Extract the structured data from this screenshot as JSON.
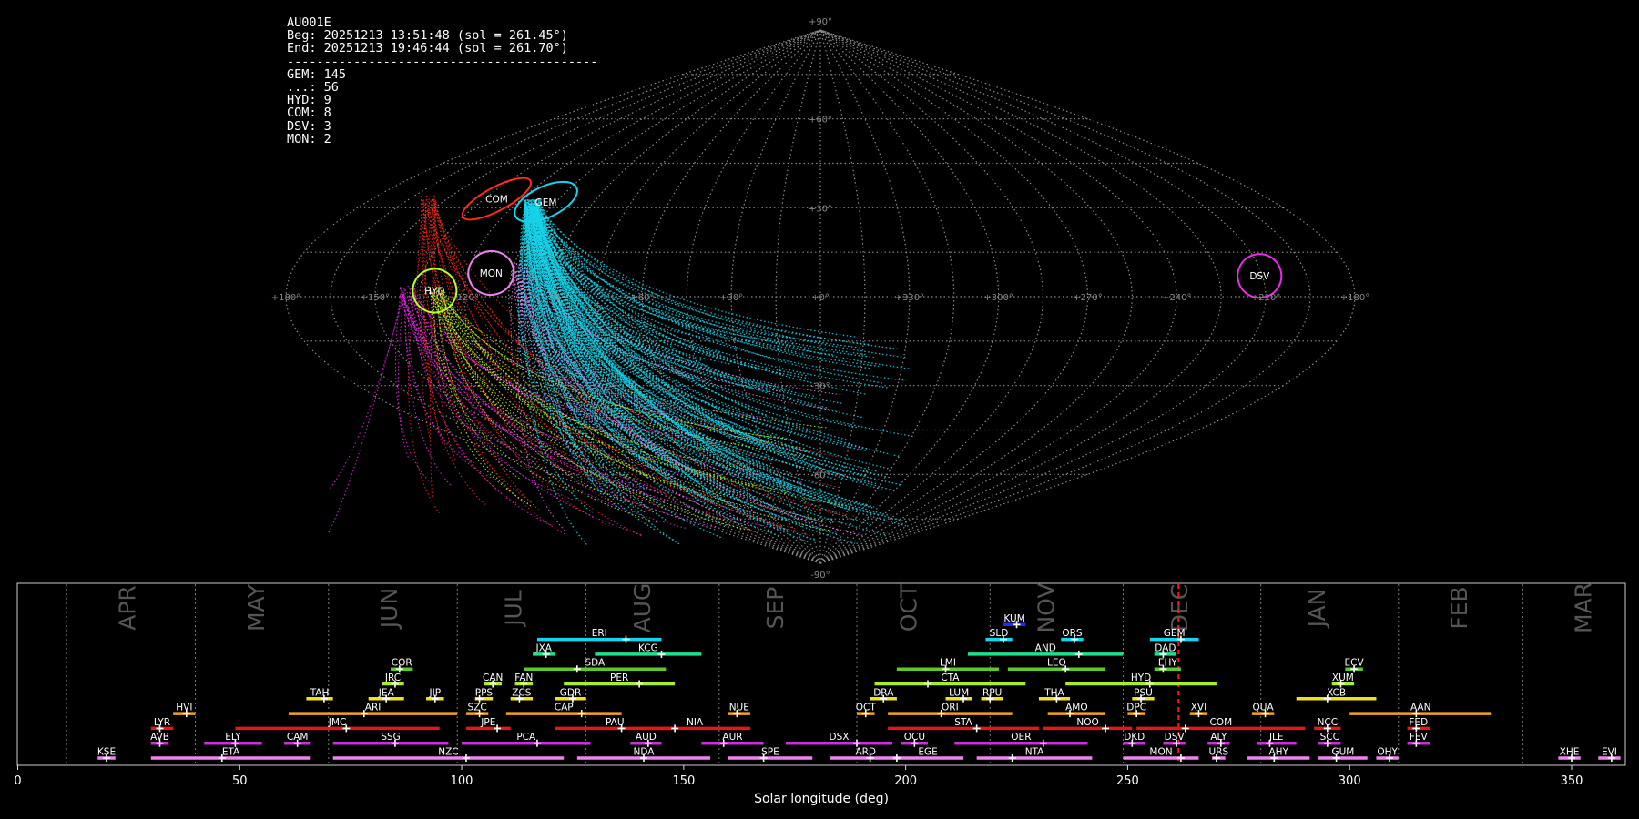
{
  "info": {
    "station": "AU001E",
    "begin": "Beg: 20251213 13:51:48 (sol = 261.45°)",
    "end": "End: 20251213 19:46:44 (sol = 261.70°)",
    "separator": "------------------------------------------",
    "counts": [
      "GEM: 145",
      "...: 56",
      "HYD: 9",
      "COM: 8",
      "DSV: 3",
      "MON: 2"
    ]
  },
  "chart_data": [
    {
      "type": "scatter",
      "projection": "sinusoidal",
      "grid": true,
      "lat_labels": [
        {
          "lat": 90,
          "text": "+90°"
        },
        {
          "lat": 60,
          "text": "+60°"
        },
        {
          "lat": 30,
          "text": "+30°"
        },
        {
          "lat": -30,
          "text": "-30°"
        },
        {
          "lat": -60,
          "text": "-60°"
        },
        {
          "lat": -90,
          "text": "-90°"
        }
      ],
      "lon_labels": [
        "+180°",
        "+150°",
        "+120°",
        "+90°",
        "+60°",
        "+30°",
        "+0°",
        "+330°",
        "+300°",
        "+270°",
        "+240°",
        "+210°",
        "+180°"
      ],
      "radiants": [
        {
          "name": "COM",
          "color": "#ff2a1a",
          "lon": 130,
          "lat": 33
        },
        {
          "name": "GEM",
          "color": "#18d4ea",
          "lon": 109,
          "lat": 32
        },
        {
          "name": "MON",
          "color": "#ee82ee",
          "lon": 112,
          "lat": 8
        },
        {
          "name": "HYD",
          "color": "#b5ff28",
          "lon": 130,
          "lat": 2
        },
        {
          "name": "DSV",
          "color": "#ee2aee",
          "lon": 211,
          "lat": 7
        }
      ]
    },
    {
      "type": "bar",
      "xlabel": "Solar longitude (deg)",
      "xlim": [
        0,
        362
      ],
      "x_ticks": [
        0,
        50,
        100,
        150,
        200,
        250,
        300,
        350
      ],
      "current_sol": 261.45,
      "month_boundaries": [
        11,
        40,
        70,
        99,
        128,
        158,
        189,
        219,
        249,
        280,
        311,
        339
      ],
      "months": [
        {
          "name": "APR",
          "sol": 25
        },
        {
          "name": "MAY",
          "sol": 54
        },
        {
          "name": "JUN",
          "sol": 84
        },
        {
          "name": "JUL",
          "sol": 112
        },
        {
          "name": "AUG",
          "sol": 141
        },
        {
          "name": "SEP",
          "sol": 171
        },
        {
          "name": "OCT",
          "sol": 201
        },
        {
          "name": "NOV",
          "sol": 232
        },
        {
          "name": "DEC",
          "sol": 262
        },
        {
          "name": "JAN",
          "sol": 293
        },
        {
          "name": "FEB",
          "sol": 325
        },
        {
          "name": "MAR",
          "sol": 353
        }
      ],
      "showers": [
        {
          "code": "KUM",
          "start": 222,
          "end": 227,
          "peak": 225,
          "row": 9,
          "color": "#1f2cff"
        },
        {
          "code": "ERI",
          "start": 117,
          "end": 145,
          "peak": 137,
          "row": 8,
          "color": "#18d4ea"
        },
        {
          "code": "SLD",
          "start": 218,
          "end": 224,
          "peak": 222,
          "row": 8,
          "color": "#18d4ea"
        },
        {
          "code": "ORS",
          "start": 235,
          "end": 240,
          "peak": 238,
          "row": 8,
          "color": "#18d4ea"
        },
        {
          "code": "GEM",
          "start": 255,
          "end": 266,
          "peak": 262,
          "row": 8,
          "color": "#18d4ea"
        },
        {
          "code": "JXA",
          "start": 116,
          "end": 121,
          "peak": 119,
          "row": 7,
          "color": "#22e08a"
        },
        {
          "code": "KCG",
          "start": 130,
          "end": 154,
          "peak": 145,
          "row": 7,
          "color": "#22e08a"
        },
        {
          "code": "AND",
          "start": 214,
          "end": 249,
          "peak": 239,
          "row": 7,
          "color": "#22e08a"
        },
        {
          "code": "DAD",
          "start": 256,
          "end": 261,
          "peak": 258,
          "row": 7,
          "color": "#22e08a"
        },
        {
          "code": "COR",
          "start": 84,
          "end": 89,
          "peak": 86,
          "row": 6,
          "color": "#5cc82a"
        },
        {
          "code": "SDA",
          "start": 114,
          "end": 146,
          "peak": 126,
          "row": 6,
          "color": "#5cc82a"
        },
        {
          "code": "LMI",
          "start": 198,
          "end": 221,
          "peak": 209,
          "row": 6,
          "color": "#5cc82a"
        },
        {
          "code": "LEO",
          "start": 223,
          "end": 245,
          "peak": 236,
          "row": 6,
          "color": "#5cc82a"
        },
        {
          "code": "EHY",
          "start": 256,
          "end": 262,
          "peak": 258,
          "row": 6,
          "color": "#5cc82a"
        },
        {
          "code": "ECV",
          "start": 299,
          "end": 303,
          "peak": 301,
          "row": 6,
          "color": "#5cc82a"
        },
        {
          "code": "JRC",
          "start": 82,
          "end": 87,
          "peak": 85,
          "row": 5,
          "color": "#a8ee30"
        },
        {
          "code": "CAN",
          "start": 105,
          "end": 109,
          "peak": 107,
          "row": 5,
          "color": "#a8ee30"
        },
        {
          "code": "FAN",
          "start": 112,
          "end": 116,
          "peak": 114,
          "row": 5,
          "color": "#a8ee30"
        },
        {
          "code": "PER",
          "start": 123,
          "end": 148,
          "peak": 140,
          "row": 5,
          "color": "#a8ee30"
        },
        {
          "code": "CTA",
          "start": 193,
          "end": 227,
          "peak": 205,
          "row": 5,
          "color": "#a8ee30"
        },
        {
          "code": "HYD",
          "start": 236,
          "end": 270,
          "peak": 255,
          "row": 5,
          "color": "#a8ee30"
        },
        {
          "code": "XUM",
          "start": 296,
          "end": 301,
          "peak": 298,
          "row": 5,
          "color": "#a8ee30"
        },
        {
          "code": "TAH",
          "start": 65,
          "end": 71,
          "peak": 69,
          "row": 4,
          "color": "#eee220"
        },
        {
          "code": "JEA",
          "start": 79,
          "end": 87,
          "peak": 83,
          "row": 4,
          "color": "#eee220"
        },
        {
          "code": "JIP",
          "start": 92,
          "end": 96,
          "peak": 94,
          "row": 4,
          "color": "#eee220"
        },
        {
          "code": "PPS",
          "start": 103,
          "end": 107,
          "peak": 104,
          "row": 4,
          "color": "#eee220"
        },
        {
          "code": "ZCS",
          "start": 111,
          "end": 116,
          "peak": 113,
          "row": 4,
          "color": "#eee220"
        },
        {
          "code": "GDR",
          "start": 121,
          "end": 128,
          "peak": 125,
          "row": 4,
          "color": "#eee220"
        },
        {
          "code": "DRA",
          "start": 192,
          "end": 198,
          "peak": 195,
          "row": 4,
          "color": "#eee220"
        },
        {
          "code": "LUM",
          "start": 209,
          "end": 215,
          "peak": 213,
          "row": 4,
          "color": "#eee220"
        },
        {
          "code": "RPU",
          "start": 217,
          "end": 222,
          "peak": 219,
          "row": 4,
          "color": "#eee220"
        },
        {
          "code": "THA",
          "start": 230,
          "end": 237,
          "peak": 234,
          "row": 4,
          "color": "#eee220"
        },
        {
          "code": "PSU",
          "start": 251,
          "end": 256,
          "peak": 253,
          "row": 4,
          "color": "#eee220"
        },
        {
          "code": "XCB",
          "start": 288,
          "end": 306,
          "peak": 295,
          "row": 4,
          "color": "#eee220"
        },
        {
          "code": "HVI",
          "start": 35,
          "end": 40,
          "peak": 38,
          "row": 3,
          "color": "#f4a020"
        },
        {
          "code": "ARI",
          "start": 61,
          "end": 99,
          "peak": 78,
          "row": 3,
          "color": "#f4a020"
        },
        {
          "code": "SZC",
          "start": 101,
          "end": 106,
          "peak": 104,
          "row": 3,
          "color": "#f4a020"
        },
        {
          "code": "CAP",
          "start": 110,
          "end": 136,
          "peak": 127,
          "row": 3,
          "color": "#f4a020"
        },
        {
          "code": "NUE",
          "start": 160,
          "end": 165,
          "peak": 162,
          "row": 3,
          "color": "#f4a020"
        },
        {
          "code": "OCT",
          "start": 189,
          "end": 193,
          "peak": 191,
          "row": 3,
          "color": "#f4a020"
        },
        {
          "code": "ORI",
          "start": 196,
          "end": 224,
          "peak": 208,
          "row": 3,
          "color": "#f4a020"
        },
        {
          "code": "AMO",
          "start": 232,
          "end": 245,
          "peak": 237,
          "row": 3,
          "color": "#f4a020"
        },
        {
          "code": "DPC",
          "start": 250,
          "end": 254,
          "peak": 252,
          "row": 3,
          "color": "#f4a020"
        },
        {
          "code": "XVI",
          "start": 264,
          "end": 268,
          "peak": 266,
          "row": 3,
          "color": "#f4a020"
        },
        {
          "code": "QUA",
          "start": 278,
          "end": 283,
          "peak": 281,
          "row": 3,
          "color": "#f4a020"
        },
        {
          "code": "AAN",
          "start": 300,
          "end": 332,
          "peak": 315,
          "row": 3,
          "color": "#f4a020"
        },
        {
          "code": "LYR",
          "start": 30,
          "end": 35,
          "peak": 32,
          "row": 2,
          "color": "#e21818"
        },
        {
          "code": "JMC",
          "start": 49,
          "end": 95,
          "peak": 74,
          "row": 2,
          "color": "#e21818"
        },
        {
          "code": "JPE",
          "start": 101,
          "end": 111,
          "peak": 108,
          "row": 2,
          "color": "#e21818"
        },
        {
          "code": "PAU",
          "start": 121,
          "end": 148,
          "peak": 136,
          "row": 2,
          "color": "#e21818"
        },
        {
          "code": "NIA",
          "start": 140,
          "end": 165,
          "peak": 148,
          "row": 2,
          "color": "#e21818"
        },
        {
          "code": "STA",
          "start": 196,
          "end": 230,
          "peak": 216,
          "row": 2,
          "color": "#e21818"
        },
        {
          "code": "NOO",
          "start": 231,
          "end": 251,
          "peak": 245,
          "row": 2,
          "color": "#e21818"
        },
        {
          "code": "COM",
          "start": 252,
          "end": 290,
          "peak": 263,
          "row": 2,
          "color": "#e21818"
        },
        {
          "code": "NCC",
          "start": 292,
          "end": 298,
          "peak": 295,
          "row": 2,
          "color": "#e21818"
        },
        {
          "code": "FED",
          "start": 313,
          "end": 318,
          "peak": 315,
          "row": 2,
          "color": "#e21818"
        },
        {
          "code": "AVB",
          "start": 30,
          "end": 34,
          "peak": 32,
          "row": 1,
          "color": "#c830d8"
        },
        {
          "code": "ELY",
          "start": 42,
          "end": 55,
          "peak": 49,
          "row": 1,
          "color": "#c830d8"
        },
        {
          "code": "CAM",
          "start": 60,
          "end": 66,
          "peak": 63,
          "row": 1,
          "color": "#c830d8"
        },
        {
          "code": "SSG",
          "start": 71,
          "end": 97,
          "peak": 85,
          "row": 1,
          "color": "#c830d8"
        },
        {
          "code": "PCA",
          "start": 100,
          "end": 129,
          "peak": 117,
          "row": 1,
          "color": "#c830d8"
        },
        {
          "code": "AUD",
          "start": 138,
          "end": 145,
          "peak": 142,
          "row": 1,
          "color": "#c830d8"
        },
        {
          "code": "AUR",
          "start": 154,
          "end": 168,
          "peak": 159,
          "row": 1,
          "color": "#c830d8"
        },
        {
          "code": "DSX",
          "start": 173,
          "end": 197,
          "peak": 189,
          "row": 1,
          "color": "#c830d8"
        },
        {
          "code": "OCU",
          "start": 199,
          "end": 205,
          "peak": 202,
          "row": 1,
          "color": "#c830d8"
        },
        {
          "code": "OER",
          "start": 211,
          "end": 241,
          "peak": 231,
          "row": 1,
          "color": "#c830d8"
        },
        {
          "code": "DKD",
          "start": 249,
          "end": 254,
          "peak": 251,
          "row": 1,
          "color": "#c830d8"
        },
        {
          "code": "DSV",
          "start": 258,
          "end": 263,
          "peak": 261,
          "row": 1,
          "color": "#c830d8"
        },
        {
          "code": "ALY",
          "start": 268,
          "end": 273,
          "peak": 271,
          "row": 1,
          "color": "#c830d8"
        },
        {
          "code": "JLE",
          "start": 279,
          "end": 288,
          "peak": 282,
          "row": 1,
          "color": "#c830d8"
        },
        {
          "code": "SCC",
          "start": 293,
          "end": 298,
          "peak": 295,
          "row": 1,
          "color": "#c830d8"
        },
        {
          "code": "FEV",
          "start": 313,
          "end": 318,
          "peak": 315,
          "row": 1,
          "color": "#c830d8"
        },
        {
          "code": "KSE",
          "start": 18,
          "end": 22,
          "peak": 20,
          "row": 0,
          "color": "#ee82ee"
        },
        {
          "code": "ETA",
          "start": 30,
          "end": 66,
          "peak": 46,
          "row": 0,
          "color": "#ee82ee"
        },
        {
          "code": "NZC",
          "start": 71,
          "end": 123,
          "peak": 101,
          "row": 0,
          "color": "#ee82ee"
        },
        {
          "code": "NDA",
          "start": 126,
          "end": 156,
          "peak": 141,
          "row": 0,
          "color": "#ee82ee"
        },
        {
          "code": "SPE",
          "start": 160,
          "end": 179,
          "peak": 168,
          "row": 0,
          "color": "#ee82ee"
        },
        {
          "code": "ARD",
          "start": 183,
          "end": 199,
          "peak": 192,
          "row": 0,
          "color": "#ee82ee"
        },
        {
          "code": "EGE",
          "start": 197,
          "end": 213,
          "peak": 198,
          "row": 0,
          "color": "#ee82ee"
        },
        {
          "code": "NTA",
          "start": 216,
          "end": 242,
          "peak": 224,
          "row": 0,
          "color": "#ee82ee"
        },
        {
          "code": "MON",
          "start": 249,
          "end": 266,
          "peak": 262,
          "row": 0,
          "color": "#ee82ee"
        },
        {
          "code": "URS",
          "start": 269,
          "end": 272,
          "peak": 270,
          "row": 0,
          "color": "#ee82ee"
        },
        {
          "code": "AHY",
          "start": 277,
          "end": 291,
          "peak": 283,
          "row": 0,
          "color": "#ee82ee"
        },
        {
          "code": "GUM",
          "start": 293,
          "end": 304,
          "peak": 297,
          "row": 0,
          "color": "#ee82ee"
        },
        {
          "code": "OHY",
          "start": 306,
          "end": 311,
          "peak": 309,
          "row": 0,
          "color": "#ee82ee"
        },
        {
          "code": "XHE",
          "start": 347,
          "end": 352,
          "peak": 350,
          "row": 0,
          "color": "#ee82ee"
        },
        {
          "code": "EVI",
          "start": 356,
          "end": 361,
          "peak": 359,
          "row": 0,
          "color": "#ee82ee"
        }
      ]
    }
  ]
}
